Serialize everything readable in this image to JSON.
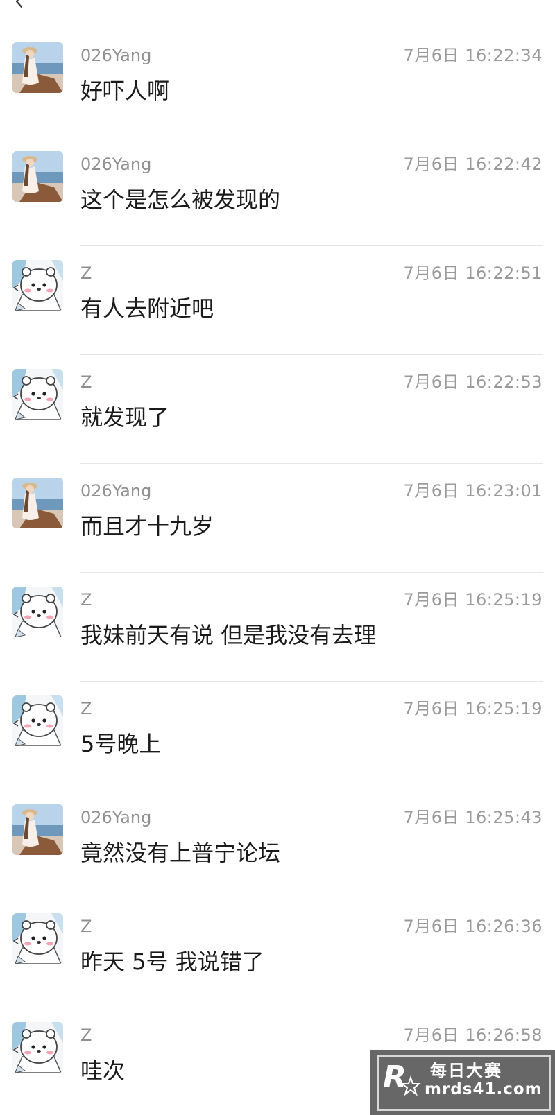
{
  "messages": [
    {
      "sender": "026Yang",
      "avatar": "girl-photo-avatar",
      "time": "7月6日 16:22:34",
      "text": "好吓人啊"
    },
    {
      "sender": "026Yang",
      "avatar": "girl-photo-avatar",
      "time": "7月6日 16:22:42",
      "text": "这个是怎么被发现的"
    },
    {
      "sender": "Z",
      "avatar": "cartoon-bear-avatar",
      "time": "7月6日 16:22:51",
      "text": "有人去附近吧"
    },
    {
      "sender": "Z",
      "avatar": "cartoon-bear-avatar",
      "time": "7月6日 16:22:53",
      "text": "就发现了"
    },
    {
      "sender": "026Yang",
      "avatar": "girl-photo-avatar",
      "time": "7月6日 16:23:01",
      "text": "而且才十九岁"
    },
    {
      "sender": "Z",
      "avatar": "cartoon-bear-avatar",
      "time": "7月6日 16:25:19",
      "text": "我妹前天有说 但是我没有去理"
    },
    {
      "sender": "Z",
      "avatar": "cartoon-bear-avatar",
      "time": "7月6日 16:25:19",
      "text": "5号晚上"
    },
    {
      "sender": "026Yang",
      "avatar": "girl-photo-avatar",
      "time": "7月6日 16:25:43",
      "text": "竟然没有上普宁论坛"
    },
    {
      "sender": "Z",
      "avatar": "cartoon-bear-avatar",
      "time": "7月6日 16:26:36",
      "text": "昨天 5号 我说错了"
    },
    {
      "sender": "Z",
      "avatar": "cartoon-bear-avatar",
      "time": "7月6日 16:26:58",
      "text": "哇次"
    }
  ],
  "watermark": {
    "logo_icon": "r-star-logo-icon",
    "title": "每日大赛",
    "url": "mrds41.com"
  }
}
